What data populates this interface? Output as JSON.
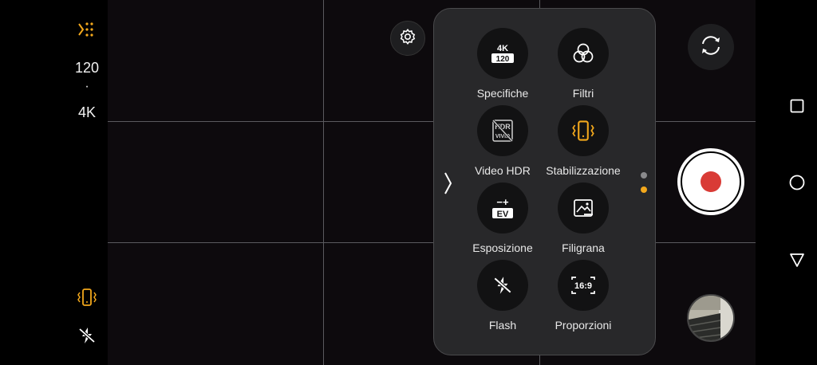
{
  "left_bar": {
    "mode_icon": "vertical-scan-icon",
    "fps": "120",
    "separator": "·",
    "resolution": "4K",
    "stabilization_icon": "stabilization-icon",
    "flash_icon": "flash-off-icon"
  },
  "settings": {
    "icon": "gear-icon"
  },
  "panel": {
    "tiles": [
      {
        "label": "Specifiche",
        "icon": "resolution-4k-120-icon",
        "badge_top": "4K",
        "badge_bottom": "120"
      },
      {
        "label": "Filtri",
        "icon": "filters-icon"
      },
      {
        "label": "Video HDR",
        "icon": "hdr-vivid-off-icon",
        "badge_top": "HDR",
        "badge_bottom": "VIVID"
      },
      {
        "label": "Stabilizzazione",
        "icon": "stabilization-icon"
      },
      {
        "label": "Esposizione",
        "icon": "exposure-ev-icon",
        "badge_top": "−+",
        "badge_bottom": "EV"
      },
      {
        "label": "Filigrana",
        "icon": "watermark-icon"
      },
      {
        "label": "Flash",
        "icon": "flash-off-icon"
      },
      {
        "label": "Proporzioni",
        "icon": "aspect-ratio-icon",
        "badge_top": "16:9"
      }
    ],
    "collapse_icon": "chevron-right-icon",
    "page_dots": {
      "count": 2,
      "active": 2
    }
  },
  "controls": {
    "switch_camera_icon": "switch-camera-icon",
    "record_icon": "record-icon",
    "gallery_icon": "gallery-thumbnail"
  },
  "nav": {
    "recents_icon": "square-icon",
    "home_icon": "circle-icon",
    "back_icon": "triangle-back-icon"
  },
  "colors": {
    "accent": "#f3a81c",
    "record": "#d93b36",
    "panel_bg": "#28282a",
    "tile_bg": "#121213"
  }
}
